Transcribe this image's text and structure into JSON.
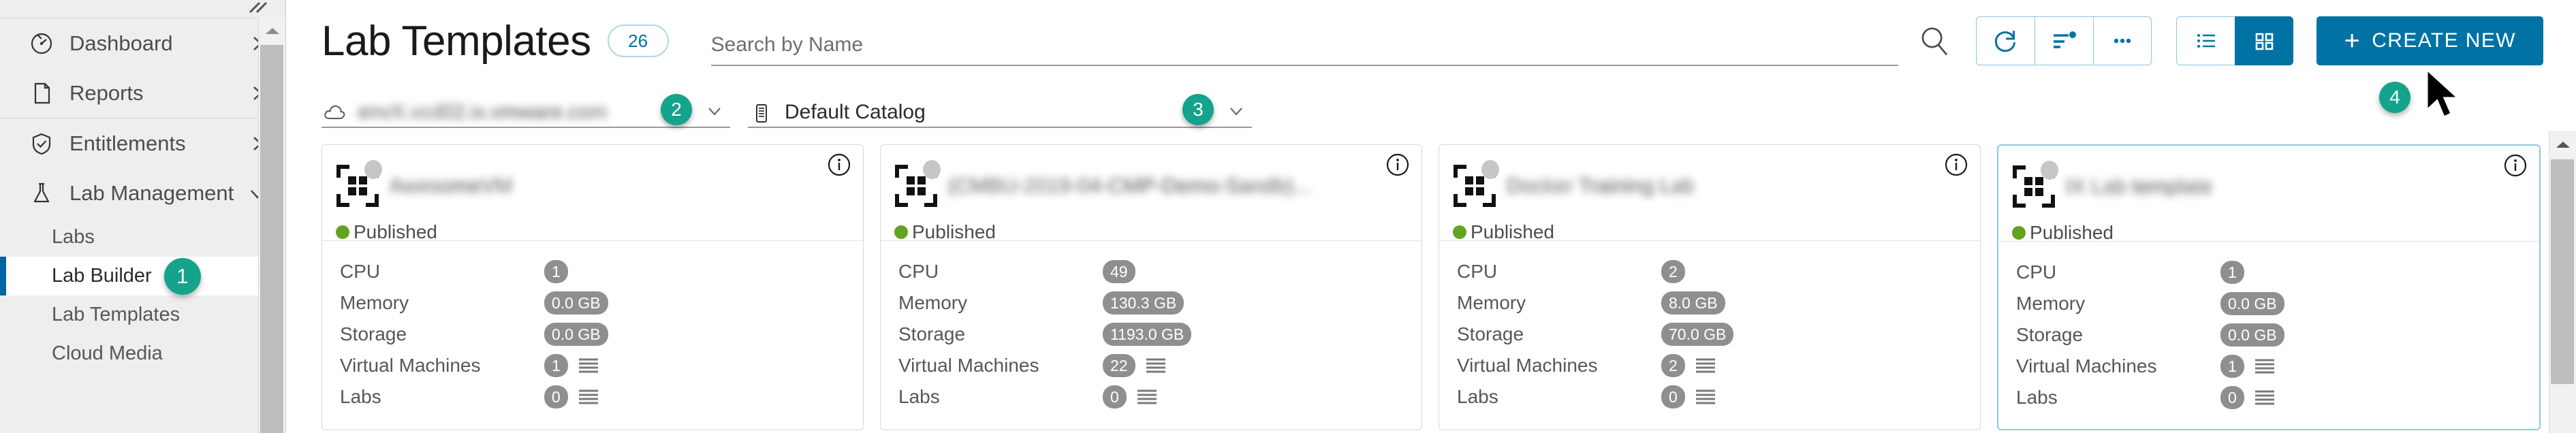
{
  "sidebar": {
    "collapse_icon": "collapse-chevrons-icon",
    "groups": [
      {
        "items": [
          {
            "label": "Dashboard",
            "icon": "dashboard-gauge-icon",
            "chevron": "chevron-right-icon"
          },
          {
            "label": "Reports",
            "icon": "document-icon",
            "chevron": "chevron-right-icon"
          }
        ]
      },
      {
        "items": [
          {
            "label": "Entitlements",
            "icon": "shield-check-icon",
            "chevron": "chevron-right-icon"
          },
          {
            "label": "Lab Management",
            "icon": "flask-icon",
            "chevron": "chevron-down-icon"
          }
        ]
      }
    ],
    "sub_items": [
      {
        "label": "Labs",
        "badge": ""
      },
      {
        "label": "Lab Builder",
        "badge": "1",
        "active": true
      },
      {
        "label": "Lab Templates",
        "badge": ""
      },
      {
        "label": "Cloud Media",
        "badge": ""
      }
    ]
  },
  "header": {
    "title": "Lab Templates",
    "count": "26",
    "search": {
      "value": "",
      "placeholder": "Search by Name"
    },
    "search_icon": "search-icon",
    "toolbar": [
      {
        "name": "refresh-button",
        "icon": "refresh-icon"
      },
      {
        "name": "sort-button",
        "icon": "sort-filter-icon"
      },
      {
        "name": "more-options-button",
        "icon": "ellipsis-icon"
      }
    ],
    "view_toggle": [
      {
        "name": "list-view-button",
        "icon": "list-view-icon",
        "active": false
      },
      {
        "name": "grid-view-button",
        "icon": "grid-view-icon",
        "active": true
      }
    ],
    "create_label": "CREATE NEW",
    "create_plus": "+"
  },
  "filters": [
    {
      "name": "cloud-account-filter",
      "icon": "cloud-icon",
      "value": "envX.vcd02.ix.vmware.com",
      "redacted": true,
      "chevron": "chevron-down-icon",
      "badge": "2"
    },
    {
      "name": "catalog-filter",
      "icon": "catalog-icon",
      "value": "Default Catalog",
      "redacted": false,
      "chevron": "chevron-down-icon",
      "badge": "3"
    }
  ],
  "create_badge": "4",
  "cards": {
    "stat_labels": [
      "CPU",
      "Memory",
      "Storage",
      "Virtual Machines",
      "Labs"
    ],
    "status_label": "Published",
    "info_icon": "info-circle-icon",
    "template_icon": "template-icon",
    "items": [
      {
        "title": "AwesomeVM",
        "redacted": true,
        "selected": false,
        "status": "Published",
        "cpu": "1",
        "memory": "0.0 GB",
        "storage": "0.0 GB",
        "vms": "1",
        "labs": "0"
      },
      {
        "title": "(CMBU-2019-04-CMP-Demo-Sandb)...",
        "redacted": true,
        "selected": false,
        "status": "Published",
        "cpu": "49",
        "memory": "130.3 GB",
        "storage": "1193.0 GB",
        "vms": "22",
        "labs": "0"
      },
      {
        "title": "Docker Training Lab",
        "redacted": true,
        "selected": false,
        "status": "Published",
        "cpu": "2",
        "memory": "8.0 GB",
        "storage": "70.0 GB",
        "vms": "2",
        "labs": "0"
      },
      {
        "title": "IX Lab template",
        "redacted": true,
        "selected": true,
        "status": "Published",
        "cpu": "1",
        "memory": "0.0 GB",
        "storage": "0.0 GB",
        "vms": "1",
        "labs": "0"
      }
    ]
  },
  "colors": {
    "accent": "#0072a3",
    "badge_teal": "#14a38b",
    "status_green": "#62a420",
    "pill_gray": "#8f8f8f",
    "sidebar_bg": "#eeeeee",
    "selected_border": "#89cbe3"
  },
  "scrollbars": {
    "sidebar": {
      "name": "sidebar-scrollbar",
      "arrow": "arrow-up-icon"
    },
    "main": {
      "name": "main-scrollbar",
      "arrow": "arrow-up-icon"
    }
  },
  "cursor": {
    "name": "mouse-cursor",
    "icon": "arrow-cursor-icon"
  }
}
